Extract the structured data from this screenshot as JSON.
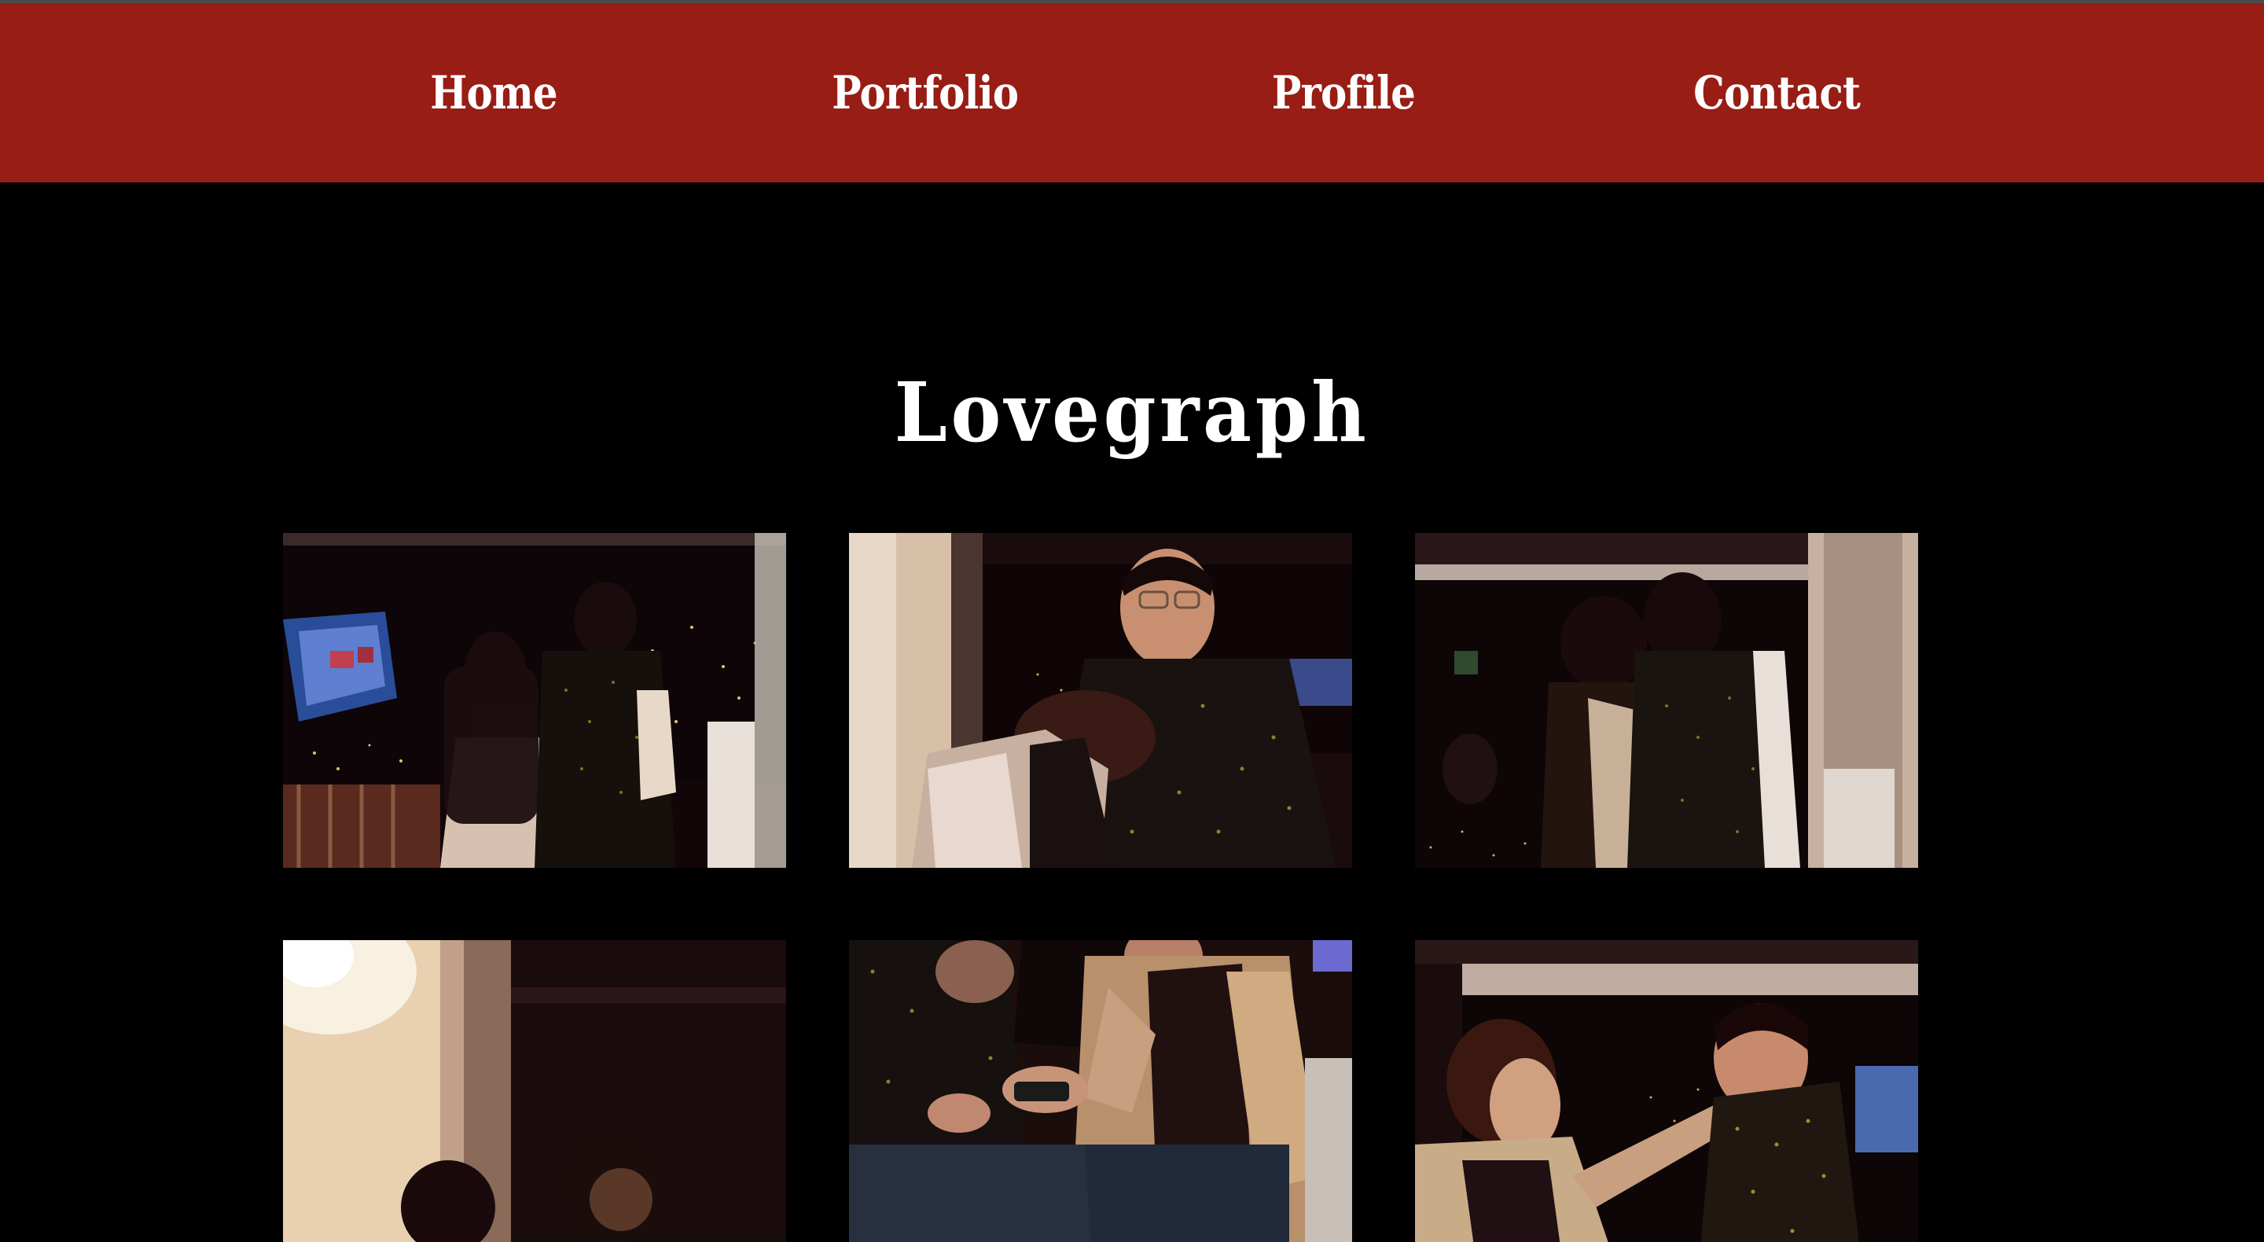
{
  "nav": {
    "home": "Home",
    "portfolio": "Portfolio",
    "profile": "Profile",
    "contact": "Contact"
  },
  "page": {
    "title": "Lovegraph"
  },
  "colors": {
    "navbar": "#981d15",
    "background": "#000000",
    "text": "#ffffff"
  },
  "gallery": {
    "photos": [
      {
        "name": "photo-couple-at-night-view"
      },
      {
        "name": "photo-man-laughing"
      },
      {
        "name": "photo-couple-by-window"
      },
      {
        "name": "photo-couple-under-lamp"
      },
      {
        "name": "photo-couple-with-phone"
      },
      {
        "name": "photo-woman-touching-face"
      }
    ]
  }
}
